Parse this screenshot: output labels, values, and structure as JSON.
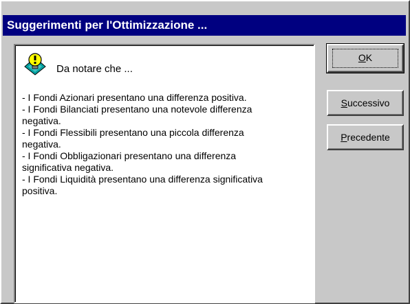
{
  "window": {
    "title": "Suggerimenti per l'Ottimizzazione ..."
  },
  "tip": {
    "icon": "lightbulb-warning-icon",
    "heading": "Da notare che ...",
    "lines": [
      "- I Fondi Azionari presentano una differenza positiva.",
      "- I Fondi Bilanciati presentano una notevole differenza",
      "negativa.",
      "- I Fondi Flessibili presentano una piccola differenza",
      "negativa.",
      "- I Fondi Obbligazionari presentano una differenza",
      "significativa negativa.",
      "- I Fondi Liquidità presentano una differenza significativa",
      "positiva."
    ]
  },
  "buttons": {
    "ok": {
      "accel": "O",
      "rest": "K"
    },
    "next": {
      "accel": "S",
      "rest": "uccessivo"
    },
    "prev": {
      "accel": "P",
      "rest": "recedente"
    }
  },
  "colors": {
    "titlebar": "#000080",
    "face": "#c8c8c8",
    "icon_yellow": "#ffff00",
    "icon_teal": "#00a0a0"
  }
}
